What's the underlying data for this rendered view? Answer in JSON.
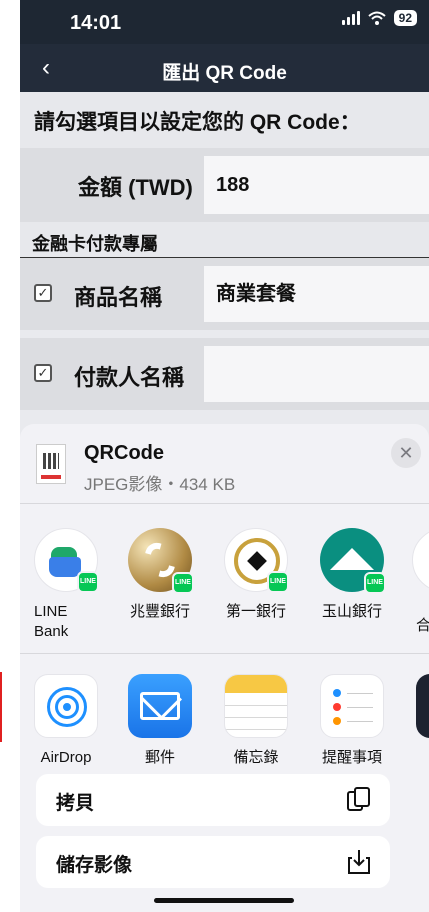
{
  "status": {
    "time": "14:01",
    "battery": "92"
  },
  "nav": {
    "back": "‹",
    "title": "匯出 QR Code"
  },
  "form": {
    "intro": "請勾選項目以設定您的 QR Code：",
    "amount_label": "金額 (TWD)",
    "amount_value": "188",
    "section": "金融卡付款專屬",
    "product_label": "商品名稱",
    "product_value": "商業套餐",
    "payer_label": "付款人名稱",
    "payer_value": "",
    "check_mark": "✓"
  },
  "sheet": {
    "file_name": "QRCode",
    "file_meta": "JPEG影像・434 KB",
    "close": "✕",
    "badge_text": "LINE",
    "apps": [
      {
        "label": "LINE\nBank",
        "icon": "line-bank-icon"
      },
      {
        "label": "兆豐銀行",
        "icon": "mega-bank-icon"
      },
      {
        "label": "第一銀行",
        "icon": "first-bank-icon"
      },
      {
        "label": "玉山銀行",
        "icon": "esun-bank-icon"
      },
      {
        "label": "合",
        "icon": "partial-bank-icon"
      }
    ],
    "actions": [
      {
        "label": "AirDrop",
        "icon": "airdrop-icon"
      },
      {
        "label": "郵件",
        "icon": "mail-icon"
      },
      {
        "label": "備忘錄",
        "icon": "notes-icon"
      },
      {
        "label": "提醒事項",
        "icon": "reminders-icon"
      }
    ],
    "copy_label": "拷貝",
    "save_label": "儲存影像"
  },
  "colors": {
    "nav_bg": "#232c3a",
    "line_green": "#06c755",
    "accent_blue": "#1e90ff"
  }
}
